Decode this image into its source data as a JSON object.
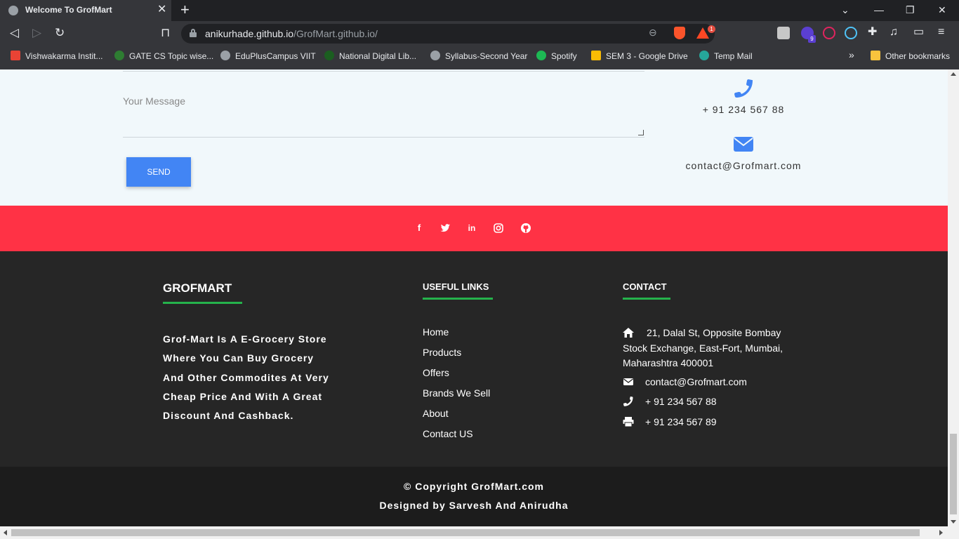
{
  "browser": {
    "tab_title": "Welcome To GrofMart",
    "tab_close": "✕",
    "new_tab": "+",
    "url_host": "anikurhade.github.io",
    "url_path": "/GrofMart.github.io/",
    "brave_badge": "1",
    "ext_badge": "9",
    "bookmarks": [
      {
        "label": "Vishwakarma Instit...",
        "icon": "gmail-icon",
        "color": "#ea4335"
      },
      {
        "label": "GATE CS Topic wise...",
        "icon": "gate-icon",
        "color": "#2e7d32"
      },
      {
        "label": "EduPlusCampus VIIT",
        "icon": "globe-icon",
        "color": "#9aa0a6"
      },
      {
        "label": "National Digital Lib...",
        "icon": "ndl-icon",
        "color": "#1b5e20"
      },
      {
        "label": "Syllabus-Second Year",
        "icon": "globe-icon",
        "color": "#9aa0a6"
      },
      {
        "label": "Spotify",
        "icon": "spotify-icon",
        "color": "#1db954"
      },
      {
        "label": "SEM 3 - Google Drive",
        "icon": "drive-icon",
        "color": "#fbbc04"
      },
      {
        "label": "Temp Mail",
        "icon": "tempmail-icon",
        "color": "#26a69a"
      }
    ],
    "bookmarks_more": "»",
    "other_bookmarks": "Other bookmarks"
  },
  "contact_form": {
    "message_placeholder": "Your Message",
    "send_label": "SEND",
    "phone": "+ 91 234 567 88",
    "email": "contact@Grofmart.com"
  },
  "social": [
    "facebook-icon",
    "twitter-icon",
    "linkedin-icon",
    "instagram-icon",
    "github-icon"
  ],
  "footer": {
    "brand_title": "GROFMART",
    "about": "Grof-Mart Is A E-Grocery Store Where You Can Buy Grocery And Other Commodites At Very Cheap Price And With A Great Discount And Cashback.",
    "links_title": "USEFUL LINKS",
    "links": [
      "Home",
      "Products",
      "Offers",
      "Brands We Sell",
      "About",
      "Contact US"
    ],
    "contact_title": "CONTACT",
    "address": "21, Dalal St, Opposite Bombay Stock Exchange, East-Fort, Mumbai, Maharashtra 400001",
    "email": "contact@Grofmart.com",
    "phone": "+ 91 234 567 88",
    "fax": "+ 91 234 567 89",
    "copyright": "© Copyright GrofMart.com",
    "designed_by": "Designed by Sarvesh And Anirudha"
  },
  "colors": {
    "accent_blue": "#4285f4",
    "social_bar": "#ff3245",
    "footer_bg": "#262626",
    "underline_green": "#25b34c"
  }
}
